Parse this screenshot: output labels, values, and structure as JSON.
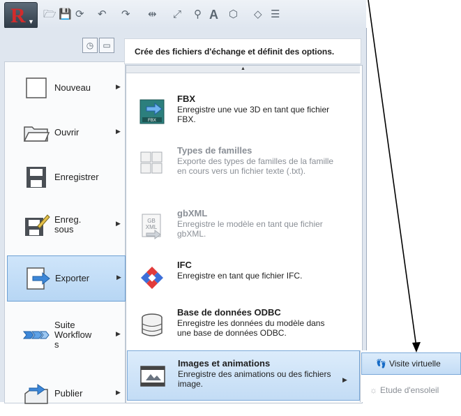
{
  "quick_access": {
    "icons": [
      "open-icon",
      "save-icon",
      "sync-icon",
      "undo-icon",
      "redo-icon",
      "measure-icon",
      "dimension-icon",
      "tag-icon",
      "text-icon",
      "3d-view-icon",
      "section-icon",
      "thin-lines-icon"
    ]
  },
  "hint": {
    "text": "Crée des fichiers d'échange et définit des options."
  },
  "left_menu": [
    {
      "label": "Nouveau",
      "arrow": true
    },
    {
      "label": "Ouvrir",
      "arrow": true
    },
    {
      "label": "Enregistrer",
      "arrow": false
    },
    {
      "label": "Enreg. sous",
      "arrow": true
    },
    {
      "label": "Exporter",
      "arrow": true,
      "selected": true
    },
    {
      "label": "Suite Workflow s",
      "arrow": true
    },
    {
      "label": "Publier",
      "arrow": true
    }
  ],
  "submenu": [
    {
      "title": "FBX",
      "desc": "Enregistre une vue 3D en tant que fichier FBX.",
      "disabled": false
    },
    {
      "title": "Types de familles",
      "desc": "Exporte des types de familles de la famille en cours vers un fichier texte (.txt).",
      "disabled": true
    },
    {
      "title": "gbXML",
      "desc": "Enregistre le modèle en tant que fichier gbXML.",
      "disabled": true
    },
    {
      "title": "IFC",
      "desc": "Enregistre en tant que fichier IFC.",
      "disabled": false
    },
    {
      "title": "Base de données ODBC",
      "desc": "Enregistre les données du modèle dans une base de données ODBC.",
      "disabled": false
    },
    {
      "title": "Images et animations",
      "desc": "Enregistre des animations ou des fichiers image.",
      "disabled": false,
      "selected": true
    }
  ],
  "flyout": [
    {
      "label": "Visite virtuelle",
      "selected": true
    },
    {
      "label": "Etude d'ensoleil",
      "disabled": true
    }
  ],
  "colors": {
    "selection": "#c3dcf5",
    "selection_border": "#7aa8d8",
    "menu_bg": "#dfe6ef",
    "logo_red": "#d22b2b"
  }
}
